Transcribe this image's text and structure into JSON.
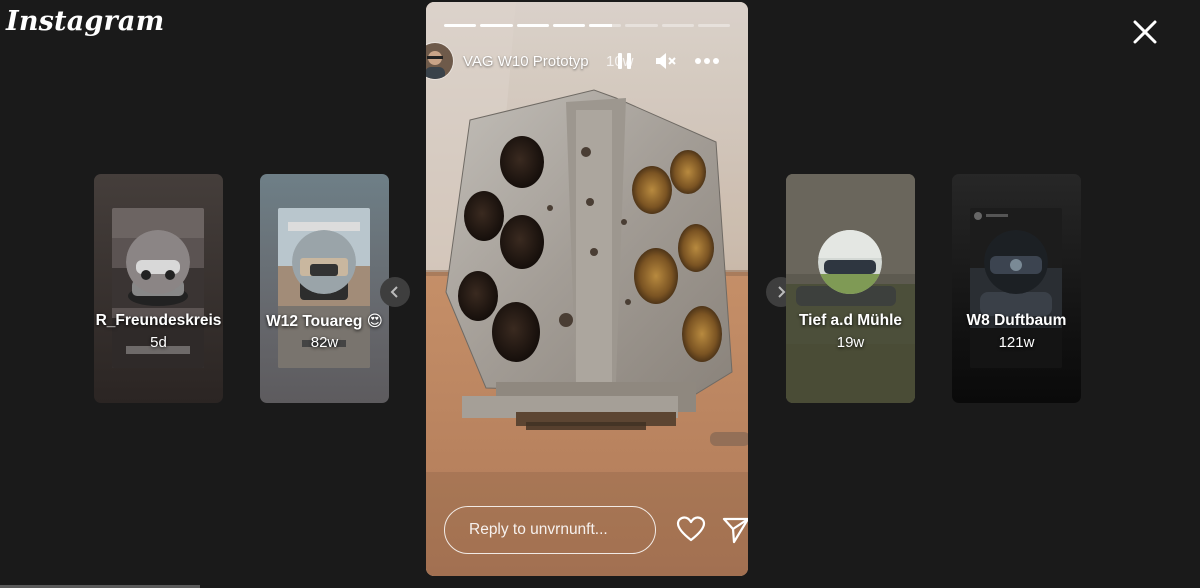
{
  "app": {
    "logo_text": "Instagram"
  },
  "close": {
    "icon": "close-icon"
  },
  "side_stories": [
    {
      "name": "R_Freundeskreis",
      "age": "5d",
      "thumb_text": "R_FREUNDESKREIS"
    },
    {
      "name": "W12 Touareg 😍",
      "age": "82w",
      "thumb_text": "W12 Powered Touareg?"
    },
    {
      "name": "Tief a.d Mühle",
      "age": "19w"
    },
    {
      "name": "W8 Duftbaum",
      "age": "121w"
    }
  ],
  "nav": {
    "prev_icon": "chevron-left-icon",
    "next_icon": "chevron-right-icon"
  },
  "story": {
    "title": "VAG W10 Prototyp",
    "age": "10w",
    "progress": {
      "segments": 8,
      "completed": 4,
      "current_fill": 0.7
    },
    "reply_placeholder": "Reply to unvrnunft...",
    "icons": {
      "pause": "pause-icon",
      "mute": "muted-speaker-icon",
      "more": "more-horizontal-icon",
      "like": "heart-icon",
      "share": "paper-plane-icon"
    }
  }
}
